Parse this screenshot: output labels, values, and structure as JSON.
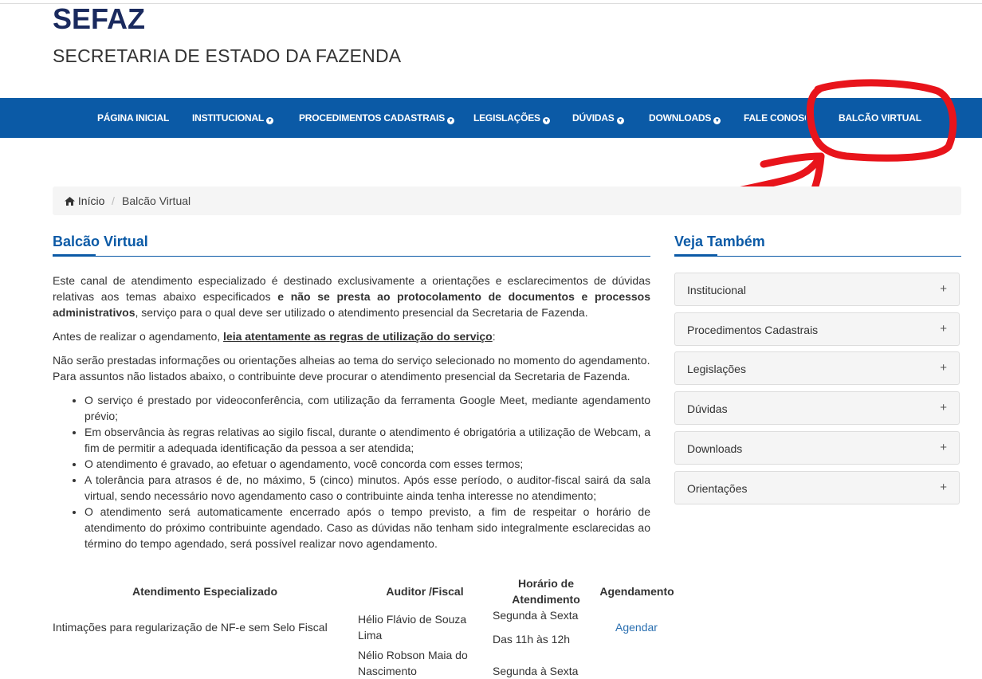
{
  "header": {
    "logo": "SEFAZ",
    "subtitle": "SECRETARIA DE ESTADO DA FAZENDA"
  },
  "nav": {
    "items": [
      {
        "label": "PÁGINA INICIAL"
      },
      {
        "label": "INSTITUCIONAL"
      },
      {
        "label": "PROCEDIMENTOS CADASTRAIS"
      },
      {
        "label": "LEGISLAÇÕES"
      },
      {
        "label": "DÚVIDAS"
      },
      {
        "label": "DOWNLOADS"
      },
      {
        "label": "FALE CONOSCO"
      },
      {
        "label": "BALCÃO VIRTUAL"
      }
    ],
    "dropdown_glyph": "▾"
  },
  "breadcrumb": {
    "home_icon": "home-icon",
    "home": "Início",
    "separator": "/",
    "current": "Balcão Virtual"
  },
  "main": {
    "title": "Balcão Virtual",
    "intro": {
      "p1_start": "Este canal de atendimento especializado é destinado exclusivamente a orientações e esclarecimentos de dúvidas relativas aos temas abaixo especificados ",
      "p1_bold": "e não se presta ao protocolamento de documentos e processos administrativos",
      "p1_end": ", serviço para o qual deve ser utilizado o atendimento presencial da Secretaria de Fazenda.",
      "p2_start": " Antes de realizar o agendamento, ",
      "p2_link": "leia atentamente as regras de utilização do serviço",
      "p2_end": ":",
      "p3": " Não serão prestadas informações ou orientações alheias ao tema do serviço selecionado no momento do agendamento. Para assuntos não listados abaixo, o contribuinte deve procurar o atendimento presencial da Secretaria de Fazenda."
    },
    "rules": [
      "O serviço é prestado por videoconferência, com utilização da ferramenta Google Meet, mediante agendamento prévio;",
      "Em observância às regras relativas ao sigilo fiscal, durante o atendimento é obrigatória a utilização de Webcam, a fim de permitir a adequada identificação da pessoa a ser atendida;",
      "O atendimento é gravado, ao efetuar o agendamento, você concorda com esses termos;",
      "A tolerância para atrasos é de, no máximo, 5 (cinco) minutos. Após esse período, o auditor-fiscal sairá da sala virtual, sendo necessário novo agendamento caso o contribuinte ainda tenha interesse no atendimento;",
      "O atendimento será automaticamente encerrado após o tempo previsto, a fim de respeitar o horário de atendimento do próximo contribuinte agendado. Caso as dúvidas não tenham sido integralmente esclarecidas ao término do tempo agendado, será possível realizar novo agendamento."
    ],
    "table": {
      "headers": [
        "Atendimento Especializado",
        "Auditor /Fiscal",
        "Horário de Atendimento",
        "Agendamento"
      ],
      "rows": [
        {
          "service": "Intimações para regularização de NF-e sem Selo Fiscal",
          "auditor": "Hélio Flávio de Souza Lima",
          "days": "Segunda à Sexta",
          "hours": "Das 11h às 12h",
          "action": "Agendar"
        },
        {
          "service": "",
          "auditor": "Nélio Robson Maia do Nascimento",
          "days": "Segunda à Sexta",
          "hours": "",
          "action": ""
        }
      ]
    }
  },
  "sidebar": {
    "title": "Veja Também",
    "items": [
      {
        "label": "Institucional",
        "toggle": "+"
      },
      {
        "label": "Procedimentos Cadastrais",
        "toggle": "+"
      },
      {
        "label": "Legislações",
        "toggle": "+"
      },
      {
        "label": "Dúvidas",
        "toggle": "+"
      },
      {
        "label": "Downloads",
        "toggle": "+"
      },
      {
        "label": "Orientações",
        "toggle": "+"
      }
    ]
  },
  "colors": {
    "nav_bg": "#0b5aa6",
    "logo": "#1a2a5e",
    "title_blue": "#0b5aa6",
    "annotation_red": "#e8141b"
  }
}
